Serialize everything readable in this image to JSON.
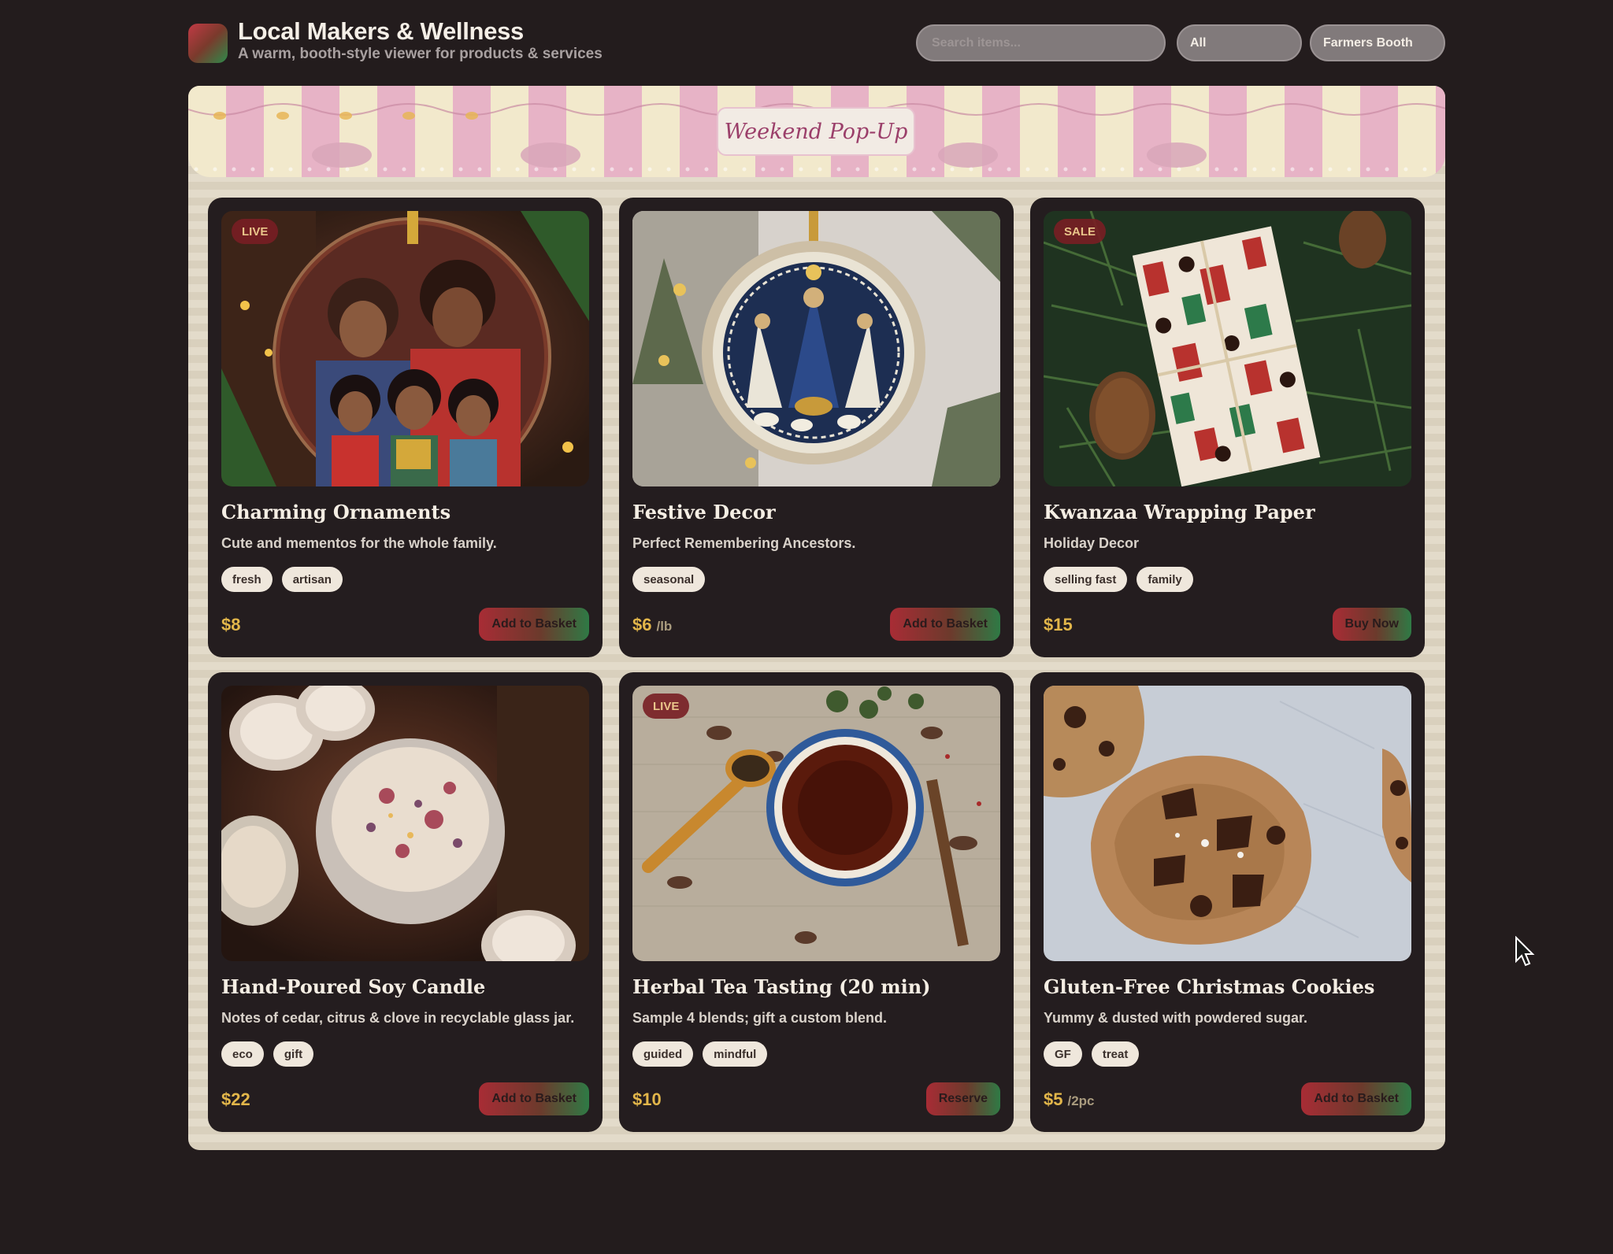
{
  "header": {
    "title": "Local Makers & Wellness",
    "subtitle": "A warm, booth-style viewer for products & services",
    "search_placeholder": "Search items...",
    "filter_category": "All",
    "filter_mode": "Farmers Booth"
  },
  "banner": {
    "sign_text": "Weekend Pop-Up"
  },
  "colors": {
    "background": "#231c1d",
    "card": "#241d1f",
    "price": "#e2b64a",
    "awning_pink": "#e7b3c6",
    "awning_cream": "#f2e9cc",
    "button_red": "#a82c35",
    "button_green": "#2f7a45"
  },
  "products": [
    {
      "name": "Charming Ornaments",
      "description": "Cute and mementos for the whole family.",
      "badge": "LIVE",
      "tags": [
        "fresh",
        "artisan"
      ],
      "price": "$8",
      "unit": "",
      "action": "Add to Basket",
      "image": "family-ornament"
    },
    {
      "name": "Festive Decor",
      "description": "Perfect Remembering Ancestors.",
      "badge": "",
      "tags": [
        "seasonal"
      ],
      "price": "$6",
      "unit": "/lb",
      "action": "Add to Basket",
      "image": "nativity-ornament"
    },
    {
      "name": "Kwanzaa Wrapping Paper",
      "description": "Holiday Decor",
      "badge": "SALE",
      "tags": [
        "selling fast",
        "family"
      ],
      "price": "$15",
      "unit": "",
      "action": "Buy Now",
      "image": "wrapped-gift"
    },
    {
      "name": "Hand-Poured Soy Candle",
      "description": "Notes of cedar, citrus & clove in recyclable glass jar.",
      "badge": "",
      "tags": [
        "eco",
        "gift"
      ],
      "price": "$22",
      "unit": "",
      "action": "Add to Basket",
      "image": "candle"
    },
    {
      "name": "Herbal Tea Tasting (20 min)",
      "description": "Sample 4 blends; gift a custom blend.",
      "badge": "LIVE",
      "tags": [
        "guided",
        "mindful"
      ],
      "price": "$10",
      "unit": "",
      "action": "Reserve",
      "image": "tea-cup"
    },
    {
      "name": "Gluten-Free Christmas Cookies",
      "description": "Yummy & dusted with powdered sugar.",
      "badge": "",
      "tags": [
        "GF",
        "treat"
      ],
      "price": "$5",
      "unit": "/2pc",
      "action": "Add to Basket",
      "image": "cookies"
    }
  ]
}
